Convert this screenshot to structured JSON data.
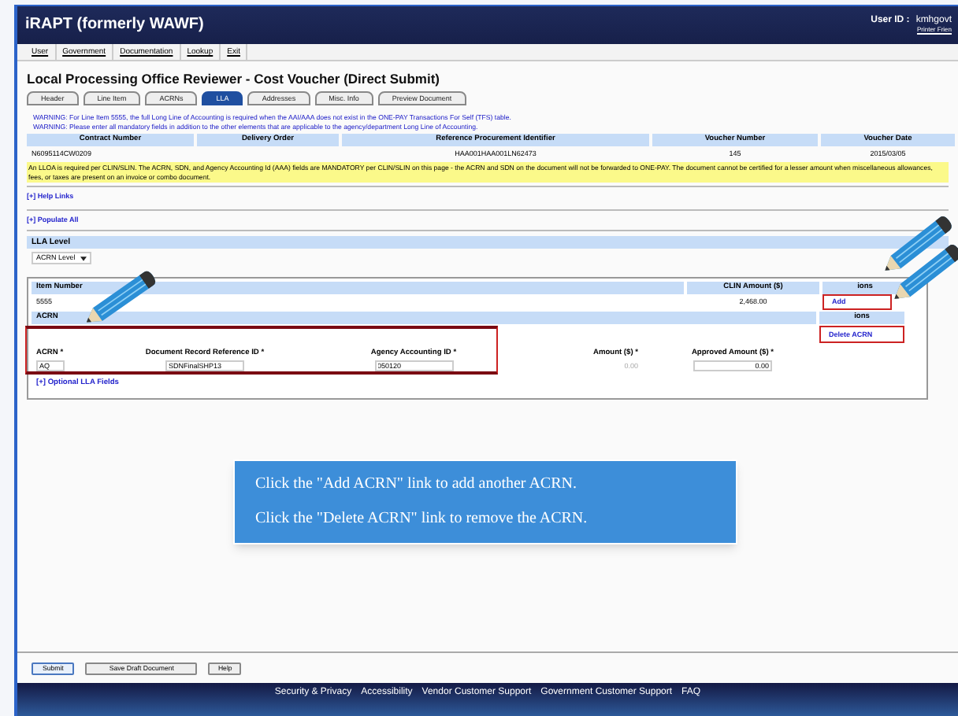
{
  "header": {
    "title": "iRAPT (formerly WAWF)",
    "user_label": "User ID :",
    "user_id": "kmhgovt",
    "printer_link": "Printer Frien"
  },
  "menu": [
    "User",
    "Government",
    "Documentation",
    "Lookup",
    "Exit"
  ],
  "page_title": "Local Processing Office Reviewer - Cost Voucher (Direct Submit)",
  "tabs": [
    {
      "label": "Header",
      "selected": false
    },
    {
      "label": "Line Item",
      "selected": false
    },
    {
      "label": "ACRNs",
      "selected": false
    },
    {
      "label": "LLA",
      "selected": true
    },
    {
      "label": "Addresses",
      "selected": false
    },
    {
      "label": "Misc. Info",
      "selected": false
    },
    {
      "label": "Preview Document",
      "selected": false
    }
  ],
  "warnings": [
    "WARNING: For Line Item 5555, the full Long Line of Accounting is required when the AAI/AAA does not exist in the ONE-PAY Transactions For Self (TFS) table.",
    "WARNING: Please enter all mandatory fields in addition to the other elements that are applicable to the agency/department Long Line of Accounting."
  ],
  "contract_table": {
    "columns": [
      "Contract Number",
      "Delivery Order",
      "Reference Procurement Identifier",
      "Voucher Number",
      "Voucher Date"
    ],
    "row": {
      "contract_number": "N6095114CW0209",
      "reference_procurement_identifier": "HAA001HAA001LN62473",
      "voucher_number": "145",
      "voucher_date": "2015/03/05"
    }
  },
  "note": "An LLOA is required per CLIN/SLIN. The ACRN, SDN, and Agency Accounting Id (AAA) fields are MANDATORY per CLIN/SLIN on this page - the ACRN and SDN on the document will not be forwarded to ONE-PAY. The document cannot be certified for a lesser amount when miscellaneous allowances, fees, or taxes are present on an invoice or combo document.",
  "links": [
    "[+] Help Links",
    "[+] Populate All"
  ],
  "lla_level": {
    "heading": "LLA Level",
    "dropdown": "ACRN Level"
  },
  "line_item": {
    "columns": [
      "Item Number",
      "CLIN Amount ($)",
      "ions"
    ],
    "row": [
      "5555",
      "2,468.00"
    ],
    "action": "Add"
  },
  "acrn": {
    "heading": "ACRN",
    "actions_heading": "ions",
    "delete": "Delete ACRN",
    "fields": [
      {
        "label": "ACRN *",
        "value": "AQ",
        "kind": "input"
      },
      {
        "label": "Document Record Reference ID *",
        "value": "SDNFinalSHP13",
        "kind": "input"
      },
      {
        "label": "Agency Accounting ID *",
        "value": "050120",
        "kind": "input"
      },
      {
        "label": "Amount ($) *",
        "value": "0.00",
        "kind": "readonly"
      },
      {
        "label": "Approved Amount ($) *",
        "value": "0.00",
        "kind": "input"
      }
    ],
    "optional_link": "[+] Optional LLA Fields"
  },
  "callout": [
    "Click the \"Add ACRN\" link to add another ACRN.",
    "Click the \"Delete ACRN\" link to remove the ACRN."
  ],
  "buttons": [
    "Submit",
    "Save Draft Document",
    "Help"
  ],
  "footer": [
    "Security & Privacy",
    "Accessibility",
    "Vendor Customer Support",
    "Government Customer Support",
    "FAQ"
  ]
}
